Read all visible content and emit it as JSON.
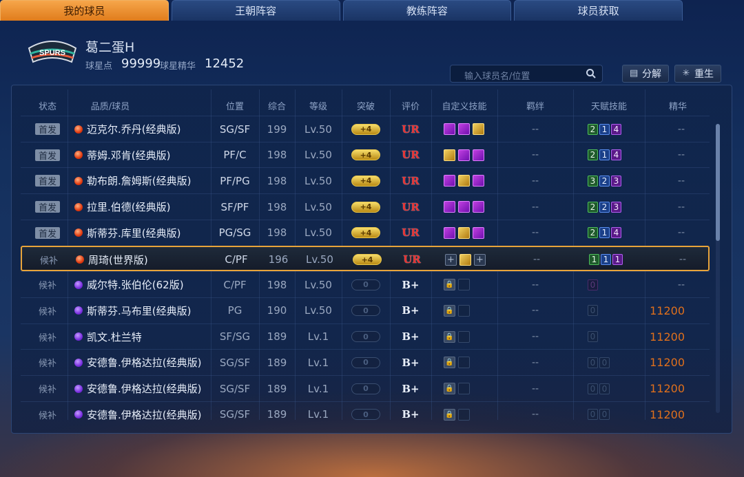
{
  "tabs": [
    {
      "label": "我的球员",
      "active": true
    },
    {
      "label": "王朝阵容",
      "active": false
    },
    {
      "label": "教练阵容",
      "active": false
    },
    {
      "label": "球员获取",
      "active": false
    }
  ],
  "header": {
    "team_logo_text": "SPURS",
    "player_name": "葛二蛋H",
    "star_points_label": "球星点",
    "star_points_value": "99999",
    "essence_label": "球星精华",
    "essence_value": "12452"
  },
  "search": {
    "placeholder": "输入球员名/位置",
    "icon": "search-icon"
  },
  "buttons": {
    "decompose": "分解",
    "decompose_icon": "document-icon",
    "rebirth": "重生",
    "rebirth_icon": "sparkle-icon"
  },
  "columns": [
    "状态",
    "品质/球员",
    "位置",
    "综合",
    "等级",
    "突破",
    "评价",
    "自定义技能",
    "羁绊",
    "天赋技能",
    "精华"
  ],
  "rows": [
    {
      "status": "首发",
      "status_type": "start",
      "quality": "red",
      "name": "迈克尔.乔丹(经典版)",
      "position": "SG/SF",
      "overall": "199",
      "level": "Lv.50",
      "breakthrough": "+4",
      "bt_type": "gold",
      "rating": "UR",
      "skills": [
        "p",
        "p",
        "g"
      ],
      "bond": "--",
      "talents": [
        {
          "v": "2",
          "c": "green"
        },
        {
          "v": "1",
          "c": "blue"
        },
        {
          "v": "4",
          "c": "purple"
        }
      ],
      "essence": "--"
    },
    {
      "status": "首发",
      "status_type": "start",
      "quality": "red",
      "name": "蒂姆.邓肯(经典版)",
      "position": "PF/C",
      "overall": "198",
      "level": "Lv.50",
      "breakthrough": "+4",
      "bt_type": "gold",
      "rating": "UR",
      "skills": [
        "g",
        "p",
        "p"
      ],
      "bond": "--",
      "talents": [
        {
          "v": "2",
          "c": "green"
        },
        {
          "v": "1",
          "c": "blue"
        },
        {
          "v": "4",
          "c": "purple"
        }
      ],
      "essence": "--"
    },
    {
      "status": "首发",
      "status_type": "start",
      "quality": "red",
      "name": "勒布朗.詹姆斯(经典版)",
      "position": "PF/PG",
      "overall": "198",
      "level": "Lv.50",
      "breakthrough": "+4",
      "bt_type": "gold",
      "rating": "UR",
      "skills": [
        "p",
        "g",
        "p"
      ],
      "bond": "--",
      "talents": [
        {
          "v": "3",
          "c": "green"
        },
        {
          "v": "2",
          "c": "blue"
        },
        {
          "v": "3",
          "c": "purple"
        }
      ],
      "essence": "--"
    },
    {
      "status": "首发",
      "status_type": "start",
      "quality": "red",
      "name": "拉里.伯德(经典版)",
      "position": "SF/PF",
      "overall": "198",
      "level": "Lv.50",
      "breakthrough": "+4",
      "bt_type": "gold",
      "rating": "UR",
      "skills": [
        "p",
        "p",
        "p"
      ],
      "bond": "--",
      "talents": [
        {
          "v": "2",
          "c": "green"
        },
        {
          "v": "2",
          "c": "blue"
        },
        {
          "v": "3",
          "c": "purple"
        }
      ],
      "essence": "--"
    },
    {
      "status": "首发",
      "status_type": "start",
      "quality": "red",
      "name": "斯蒂芬.库里(经典版)",
      "position": "PG/SG",
      "overall": "198",
      "level": "Lv.50",
      "breakthrough": "+4",
      "bt_type": "gold",
      "rating": "UR",
      "skills": [
        "p",
        "g",
        "p"
      ],
      "bond": "--",
      "talents": [
        {
          "v": "2",
          "c": "green"
        },
        {
          "v": "1",
          "c": "blue"
        },
        {
          "v": "4",
          "c": "purple"
        }
      ],
      "essence": "--"
    },
    {
      "status": "候补",
      "status_type": "sub",
      "quality": "red",
      "name": "周琦(世界版)",
      "position": "C/PF",
      "overall": "196",
      "level": "Lv.50",
      "breakthrough": "+4",
      "bt_type": "gold",
      "rating": "UR",
      "skills": [
        "plus",
        "g",
        "plus"
      ],
      "bond": "--",
      "talents": [
        {
          "v": "1",
          "c": "green"
        },
        {
          "v": "1",
          "c": "blue"
        },
        {
          "v": "1",
          "c": "purple"
        }
      ],
      "essence": "--",
      "selected": true
    },
    {
      "status": "候补",
      "status_type": "sub",
      "quality": "purple",
      "name": "威尔特.张伯伦(62版)",
      "position": "C/PF",
      "overall": "198",
      "level": "Lv.50",
      "breakthrough": "0",
      "bt_type": "empty",
      "rating": "B+",
      "skills": [
        "lock",
        "emp"
      ],
      "bond": "--",
      "talents": [
        {
          "v": "0",
          "c": "dimp"
        }
      ],
      "essence": "--"
    },
    {
      "status": "候补",
      "status_type": "sub",
      "quality": "purple",
      "name": "斯蒂芬.马布里(经典版)",
      "position": "PG",
      "overall": "190",
      "level": "Lv.50",
      "breakthrough": "0",
      "bt_type": "empty",
      "rating": "B+",
      "skills": [
        "lock",
        "emp"
      ],
      "bond": "--",
      "talents": [
        {
          "v": "0",
          "c": "dim"
        }
      ],
      "essence": "11200"
    },
    {
      "status": "候补",
      "status_type": "sub",
      "quality": "purple",
      "name": "凯文.杜兰特",
      "position": "SF/SG",
      "overall": "189",
      "level": "Lv.1",
      "breakthrough": "0",
      "bt_type": "empty",
      "rating": "B+",
      "skills": [
        "lock",
        "emp"
      ],
      "bond": "--",
      "talents": [
        {
          "v": "0",
          "c": "dim"
        }
      ],
      "essence": "11200"
    },
    {
      "status": "候补",
      "status_type": "sub",
      "quality": "purple",
      "name": "安德鲁.伊格达拉(经典版)",
      "position": "SG/SF",
      "overall": "189",
      "level": "Lv.1",
      "breakthrough": "0",
      "bt_type": "empty",
      "rating": "B+",
      "skills": [
        "lock",
        "emp"
      ],
      "bond": "--",
      "talents": [
        {
          "v": "0",
          "c": "dim"
        },
        {
          "v": "0",
          "c": "dim"
        }
      ],
      "essence": "11200"
    },
    {
      "status": "候补",
      "status_type": "sub",
      "quality": "purple",
      "name": "安德鲁.伊格达拉(经典版)",
      "position": "SG/SF",
      "overall": "189",
      "level": "Lv.1",
      "breakthrough": "0",
      "bt_type": "empty",
      "rating": "B+",
      "skills": [
        "lock",
        "emp"
      ],
      "bond": "--",
      "talents": [
        {
          "v": "0",
          "c": "dim"
        },
        {
          "v": "0",
          "c": "dim"
        }
      ],
      "essence": "11200"
    },
    {
      "status": "候补",
      "status_type": "sub",
      "quality": "purple",
      "name": "安德鲁.伊格达拉(经典版)",
      "position": "SG/SF",
      "overall": "189",
      "level": "Lv.1",
      "breakthrough": "0",
      "bt_type": "empty",
      "rating": "B+",
      "skills": [
        "lock",
        "emp"
      ],
      "bond": "--",
      "talents": [
        {
          "v": "0",
          "c": "dim"
        },
        {
          "v": "0",
          "c": "dim"
        }
      ],
      "essence": "11200"
    }
  ]
}
